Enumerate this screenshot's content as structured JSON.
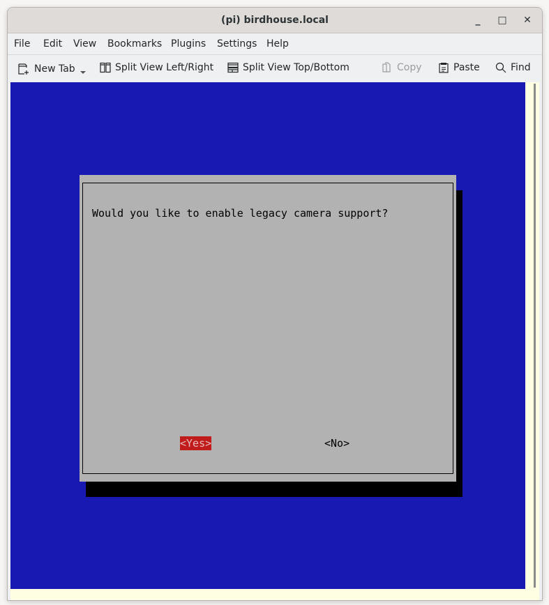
{
  "window": {
    "title": "(pi) birdhouse.local",
    "controls": {
      "minimize": "_",
      "maximize": "□",
      "close": "✕"
    }
  },
  "menubar": {
    "items": [
      "File",
      "Edit",
      "View",
      "Bookmarks",
      "Plugins",
      "Settings",
      "Help"
    ]
  },
  "toolbar": {
    "new_tab": "New Tab",
    "split_lr": "Split View Left/Right",
    "split_tb": "Split View Top/Bottom",
    "copy": "Copy",
    "paste": "Paste",
    "find": "Find"
  },
  "dialog": {
    "question": "Would you like to enable legacy camera support?",
    "yes": "<Yes>",
    "no": "<No>",
    "selected": "yes"
  },
  "colors": {
    "terminal_bg": "#1818b2",
    "dialog_bg": "#b2b2b2",
    "selected_button_bg": "#c01c1c"
  }
}
